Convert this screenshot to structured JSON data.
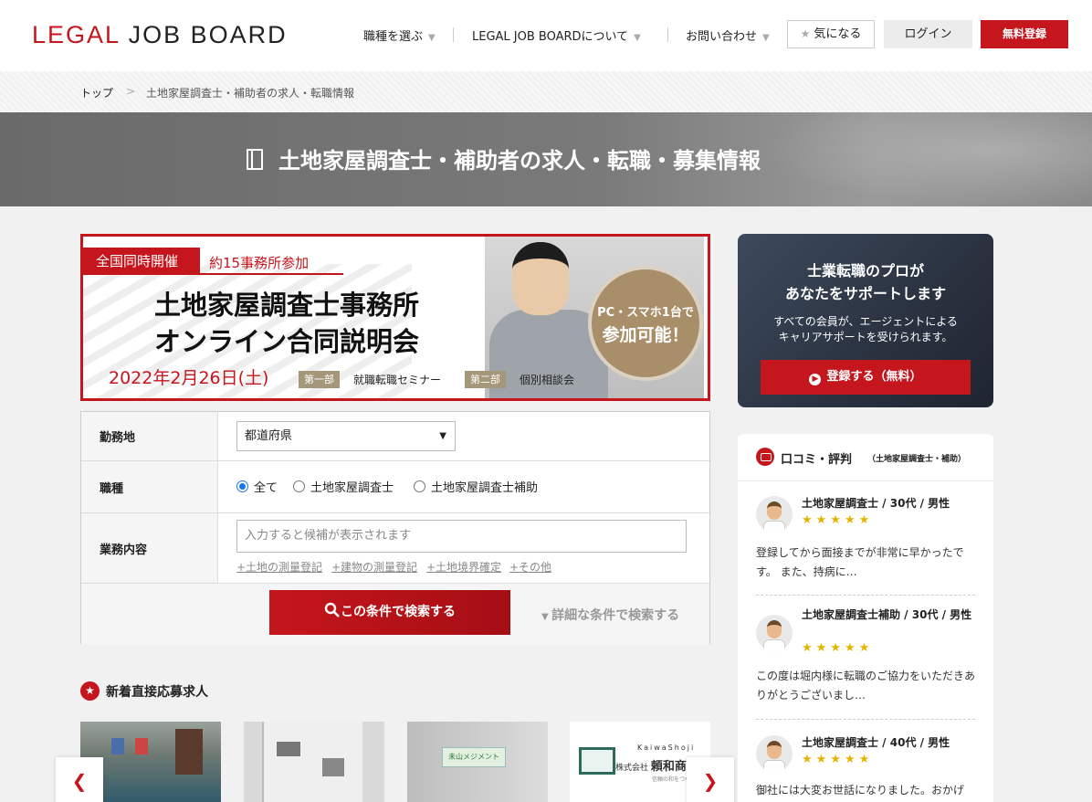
{
  "header": {
    "logo_red": "LEGAL",
    "logo_black": "JOB BOARD",
    "nav": [
      "職種を選ぶ",
      "LEGAL JOB BOARDについて",
      "お問い合わせ"
    ],
    "favorites_label": "気になる",
    "login_label": "ログイン",
    "register_label": "無料登録"
  },
  "breadcrumb": [
    "トップ",
    "土地家屋調査士・補助者の求人・転職情報"
  ],
  "page_title": "土地家屋調査士・補助者の求人・転職・募集情報",
  "seminar": {
    "tag1": "全国同時開催",
    "tag2": "約15事務所参加",
    "heading_line1": "土地家屋調査士事務所",
    "heading_line2": "オンライン合同説明会",
    "date": "2022年2月26日(土)",
    "part1_label": "第一部",
    "part1_text": "就職転職セミナー",
    "part2_label": "第二部",
    "part2_text": "個別相談会",
    "badge_line1": "PC・スマホ1台で",
    "badge_line2": "参加可能！"
  },
  "search": {
    "location_label": "勤務地",
    "location_value": "都道府県",
    "job_label": "職種",
    "job_options": [
      "全て",
      "土地家屋調査士",
      "土地家屋調査士補助"
    ],
    "job_selected": "全て",
    "work_label": "業務内容",
    "work_placeholder": "入力すると候補が表示されます",
    "keywords": [
      "+土地の測量登記",
      "+建物の測量登記",
      "+土地境界確定",
      "+その他"
    ],
    "search_button": "この条件で検索する",
    "advanced_link": "詳細な条件で検索する"
  },
  "new_jobs": {
    "title": "新着直接応募求人",
    "card4_brand": "KaiwaShoji",
    "card4_company_prefix": "株式会社",
    "card4_company": "頼和商",
    "card4_tagline": "信頼の和をつなぐ",
    "card3_sign": "未山メジメント"
  },
  "support": {
    "heading_line1": "士業転職のプロが",
    "heading_line2": "あなたをサポートします",
    "text_line1": "すべての会員が、エージェントによる",
    "text_line2": "キャリアサポートを受けられます。",
    "button": "登録する（無料）"
  },
  "reviews": {
    "title": "口コミ・評判",
    "subtitle": "（土地家屋調査士・補助）",
    "items": [
      {
        "name": "土地家屋調査士 / 30代 / 男性",
        "stars": "★★★★★",
        "text": "登録してから面接までが非常に早かったです。 また、持病に…"
      },
      {
        "name": "土地家屋調査士補助 / 30代 / 男性",
        "stars": "★★★★★",
        "text": "この度は堀内様に転職のご協力をいただきありがとうございまし…"
      },
      {
        "name": "土地家屋調査士 / 40代 / 男性",
        "stars": "★★★★★",
        "text": "御社には大変お世話になりました。おかげ"
      }
    ]
  },
  "colors": {
    "accent": "#c4161c",
    "star": "#e6b400"
  },
  "icons": [
    "star-icon",
    "book-icon",
    "search-icon",
    "chevron-left-icon",
    "chevron-right-icon",
    "speech-bubble-icon"
  ]
}
